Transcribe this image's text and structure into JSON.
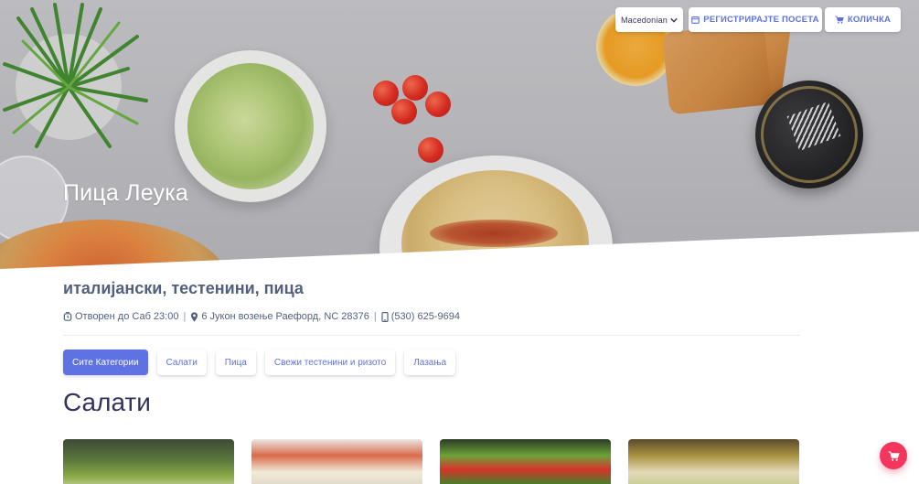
{
  "header": {
    "language_label": "Macedonian",
    "register_label": "РЕГИСТРИРАЈТЕ ПОСЕТА",
    "cart_label": "КОЛИЧКА"
  },
  "restaurant": {
    "name": "Пица Леука",
    "cuisines": "италијански, тестенини, пица",
    "open_status": "Отворен до Саб 23:00",
    "address": "6 Јукон возење Раефорд, NC 28376",
    "phone": "(530) 625-9694"
  },
  "categories": [
    {
      "label": "Сите Категории",
      "active": true
    },
    {
      "label": "Салати",
      "active": false
    },
    {
      "label": "Пица",
      "active": false
    },
    {
      "label": "Свежи тестенини и ризото",
      "active": false
    },
    {
      "label": "Лазања",
      "active": false
    }
  ],
  "section": {
    "title": "Салати"
  },
  "icons": {
    "language": "chevron-down-icon",
    "register": "calendar-icon",
    "cart": "shopping-cart-icon",
    "open": "clock-icon",
    "address": "map-pin-icon",
    "phone": "mobile-icon",
    "fab": "shopping-cart-icon"
  },
  "colors": {
    "primary": "#5e72e4",
    "danger": "#f5365c",
    "text": "#525f7f"
  }
}
